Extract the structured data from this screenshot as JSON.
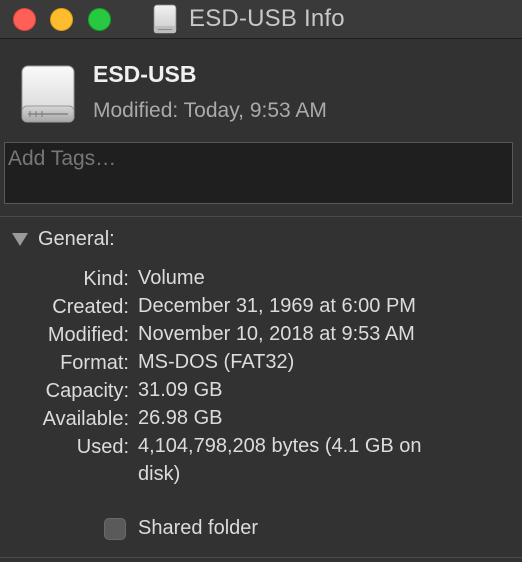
{
  "window": {
    "title": "ESD-USB Info"
  },
  "colors": {
    "close": "#fe5f57",
    "minimize": "#febc2e",
    "maximize": "#28c840",
    "background": "#323232"
  },
  "header": {
    "name": "ESD-USB",
    "modified": "Modified: Today, 9:53 AM",
    "icon": "drive-icon"
  },
  "tags": {
    "placeholder": "Add Tags…",
    "value": ""
  },
  "general": {
    "title": "General:",
    "rows": [
      {
        "label": "Kind:",
        "value": "Volume"
      },
      {
        "label": "Created:",
        "value": "December 31, 1969 at 6:00 PM"
      },
      {
        "label": "Modified:",
        "value": "November 10, 2018 at 9:53 AM"
      },
      {
        "label": "Format:",
        "value": "MS-DOS (FAT32)"
      },
      {
        "label": "Capacity:",
        "value": "31.09 GB"
      },
      {
        "label": "Available:",
        "value": "26.98 GB"
      },
      {
        "label": "Used:",
        "value": "4,104,798,208 bytes (4.1 GB on disk)"
      }
    ],
    "shared_folder": {
      "label": "Shared folder",
      "checked": false
    }
  }
}
